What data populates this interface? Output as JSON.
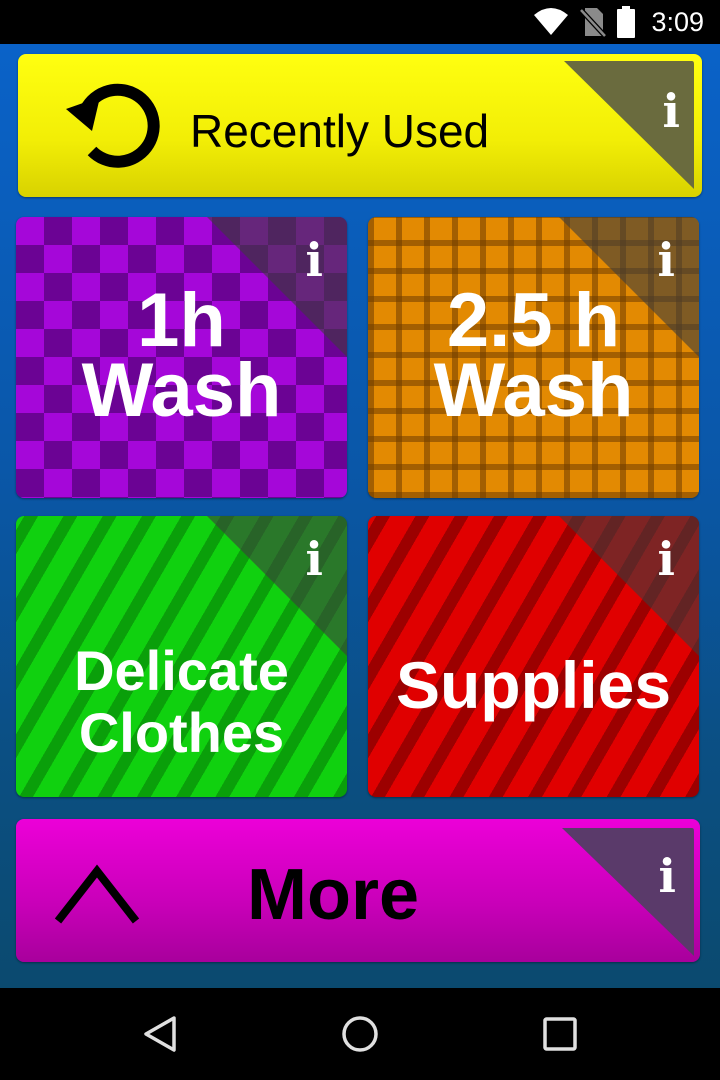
{
  "status_bar": {
    "time": "3:09",
    "icons": [
      "wifi-icon",
      "no-sim-icon",
      "battery-icon"
    ]
  },
  "tiles": {
    "recent": {
      "label": "Recently Used",
      "info": "i",
      "color": "#f2ee06",
      "icon": "refresh-icon"
    },
    "wash_1h": {
      "line1": "1h",
      "line2": "Wash",
      "info": "i",
      "color": "#a507d9"
    },
    "wash_25h": {
      "line1": "2.5 h",
      "line2": "Wash",
      "info": "i",
      "color": "#e38a02"
    },
    "delicate": {
      "line1": "Delicate",
      "line2": "Clothes",
      "info": "i",
      "color": "#10d10f"
    },
    "supplies": {
      "label": "Supplies",
      "info": "i",
      "color": "#e00000"
    },
    "more": {
      "label": "More",
      "info": "i",
      "color": "#c800b8",
      "icon": "chevron-up-icon"
    }
  },
  "nav_bar": {
    "buttons": [
      "back-icon",
      "home-icon",
      "recents-icon"
    ]
  }
}
